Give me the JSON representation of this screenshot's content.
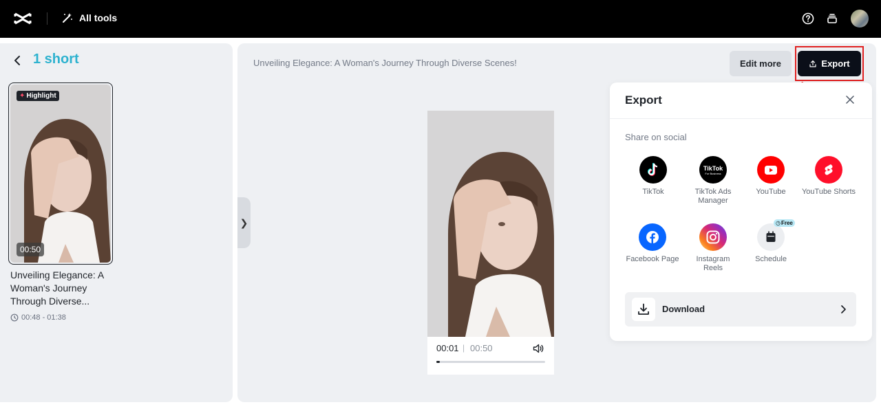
{
  "header": {
    "logo": "capcut-logo",
    "all_tools_label": "All tools",
    "icons": [
      "help-icon",
      "stack-icon",
      "avatar"
    ]
  },
  "sidebar": {
    "title": "1 short",
    "clip": {
      "badge": "Highlight",
      "duration": "00:50",
      "title": "Unveiling Elegance: A Woman's Journey Through Diverse...",
      "time_range": "00:48 - 01:38"
    }
  },
  "main": {
    "video_title": "Unveiling Elegance: A Woman's Journey Through Diverse Scenes!",
    "edit_more_label": "Edit more",
    "export_label": "Export",
    "player": {
      "current_time": "00:01",
      "separator": "|",
      "total_time": "00:50",
      "progress": 0.03
    }
  },
  "export_panel": {
    "title": "Export",
    "share_label": "Share on social",
    "platforms": [
      {
        "name": "TikTok",
        "icon": "tiktok-icon"
      },
      {
        "name": "TikTok Ads Manager",
        "icon": "tiktok-business-icon"
      },
      {
        "name": "YouTube",
        "icon": "youtube-icon"
      },
      {
        "name": "YouTube Shorts",
        "icon": "youtube-shorts-icon"
      },
      {
        "name": "Facebook Page",
        "icon": "facebook-icon"
      },
      {
        "name": "Instagram Reels",
        "icon": "instagram-icon"
      },
      {
        "name": "Schedule",
        "icon": "calendar-icon",
        "tag": "Free"
      }
    ],
    "tiktok_business_logo": "TikTok",
    "tiktok_business_sub": "For Business",
    "download_label": "Download"
  },
  "colors": {
    "accent": "#2db2cf",
    "annotation": "#e02020",
    "export_button": "#0b0f19"
  }
}
